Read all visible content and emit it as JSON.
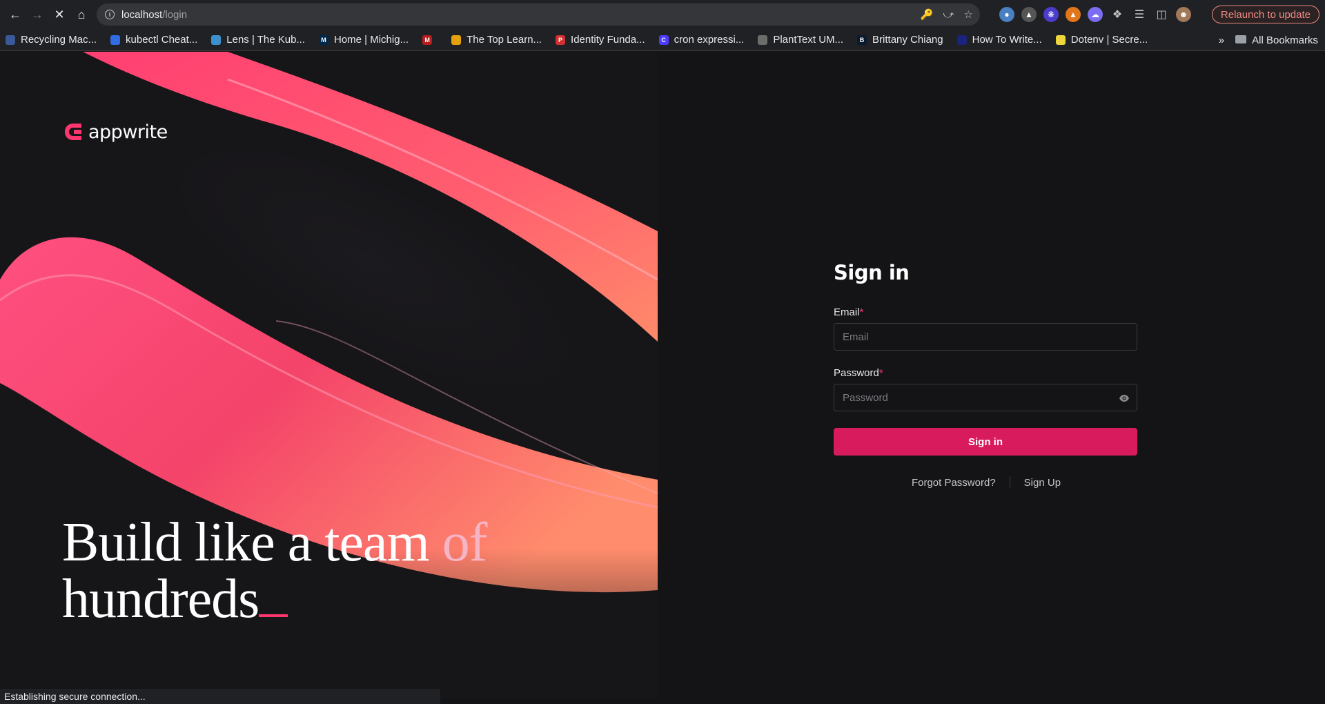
{
  "browser": {
    "url_host": "localhost",
    "url_path": "/login",
    "relaunch_label": "Relaunch to update",
    "bookmarks": [
      {
        "label": "Recycling Mac...",
        "color": "#3b5998",
        "glyph": ""
      },
      {
        "label": "kubectl Cheat...",
        "color": "#326ce5",
        "glyph": ""
      },
      {
        "label": "Lens | The Kub...",
        "color": "#3d90ce",
        "glyph": ""
      },
      {
        "label": "Home | Michig...",
        "color": "#00274c",
        "glyph": "M"
      },
      {
        "label": "",
        "color": "#b71c1c",
        "glyph": "M"
      },
      {
        "label": "The Top Learn...",
        "color": "#e5a00d",
        "glyph": ""
      },
      {
        "label": "Identity Funda...",
        "color": "#d32f2f",
        "glyph": "P"
      },
      {
        "label": "cron expressi...",
        "color": "#4a3aff",
        "glyph": "C"
      },
      {
        "label": "PlantText UM...",
        "color": "#6c6c6c",
        "glyph": ""
      },
      {
        "label": "Brittany Chiang",
        "color": "#0a192f",
        "glyph": "B"
      },
      {
        "label": "How To Write...",
        "color": "#1a237e",
        "glyph": ""
      },
      {
        "label": "Dotenv | Secre...",
        "color": "#ecd53f",
        "glyph": ""
      }
    ],
    "more_label": "»",
    "all_bookmarks_label": "All Bookmarks",
    "status_text": "Establishing secure connection..."
  },
  "hero": {
    "logo_text": "appwrite",
    "tagline_line1_a": "Build like a team ",
    "tagline_line1_b": "of",
    "tagline_line2": "hundreds"
  },
  "form": {
    "title": "Sign in",
    "email_label": "Email",
    "email_placeholder": "Email",
    "password_label": "Password",
    "password_placeholder": "Password",
    "required_mark": "*",
    "submit_label": "Sign in",
    "forgot_label": "Forgot Password?",
    "signup_label": "Sign Up"
  },
  "colors": {
    "accent": "#fd366e",
    "button": "#d81b5c",
    "background": "#141416"
  }
}
